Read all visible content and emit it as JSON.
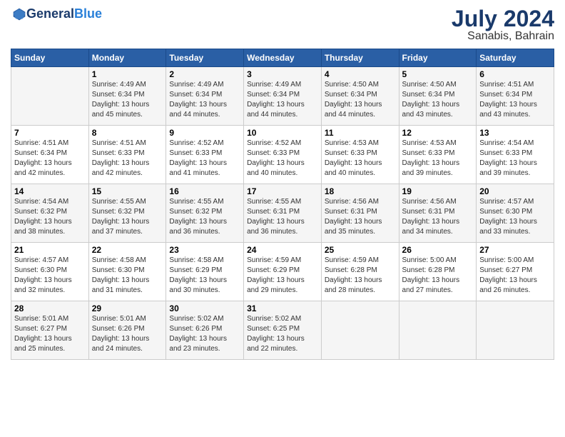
{
  "header": {
    "logo_line1": "General",
    "logo_line2": "Blue",
    "month_year": "July 2024",
    "location": "Sanabis, Bahrain"
  },
  "calendar": {
    "days_of_week": [
      "Sunday",
      "Monday",
      "Tuesday",
      "Wednesday",
      "Thursday",
      "Friday",
      "Saturday"
    ],
    "weeks": [
      [
        {
          "day": "",
          "info": ""
        },
        {
          "day": "1",
          "info": "Sunrise: 4:49 AM\nSunset: 6:34 PM\nDaylight: 13 hours\nand 45 minutes."
        },
        {
          "day": "2",
          "info": "Sunrise: 4:49 AM\nSunset: 6:34 PM\nDaylight: 13 hours\nand 44 minutes."
        },
        {
          "day": "3",
          "info": "Sunrise: 4:49 AM\nSunset: 6:34 PM\nDaylight: 13 hours\nand 44 minutes."
        },
        {
          "day": "4",
          "info": "Sunrise: 4:50 AM\nSunset: 6:34 PM\nDaylight: 13 hours\nand 44 minutes."
        },
        {
          "day": "5",
          "info": "Sunrise: 4:50 AM\nSunset: 6:34 PM\nDaylight: 13 hours\nand 43 minutes."
        },
        {
          "day": "6",
          "info": "Sunrise: 4:51 AM\nSunset: 6:34 PM\nDaylight: 13 hours\nand 43 minutes."
        }
      ],
      [
        {
          "day": "7",
          "info": "Sunrise: 4:51 AM\nSunset: 6:34 PM\nDaylight: 13 hours\nand 42 minutes."
        },
        {
          "day": "8",
          "info": "Sunrise: 4:51 AM\nSunset: 6:33 PM\nDaylight: 13 hours\nand 42 minutes."
        },
        {
          "day": "9",
          "info": "Sunrise: 4:52 AM\nSunset: 6:33 PM\nDaylight: 13 hours\nand 41 minutes."
        },
        {
          "day": "10",
          "info": "Sunrise: 4:52 AM\nSunset: 6:33 PM\nDaylight: 13 hours\nand 40 minutes."
        },
        {
          "day": "11",
          "info": "Sunrise: 4:53 AM\nSunset: 6:33 PM\nDaylight: 13 hours\nand 40 minutes."
        },
        {
          "day": "12",
          "info": "Sunrise: 4:53 AM\nSunset: 6:33 PM\nDaylight: 13 hours\nand 39 minutes."
        },
        {
          "day": "13",
          "info": "Sunrise: 4:54 AM\nSunset: 6:33 PM\nDaylight: 13 hours\nand 39 minutes."
        }
      ],
      [
        {
          "day": "14",
          "info": "Sunrise: 4:54 AM\nSunset: 6:32 PM\nDaylight: 13 hours\nand 38 minutes."
        },
        {
          "day": "15",
          "info": "Sunrise: 4:55 AM\nSunset: 6:32 PM\nDaylight: 13 hours\nand 37 minutes."
        },
        {
          "day": "16",
          "info": "Sunrise: 4:55 AM\nSunset: 6:32 PM\nDaylight: 13 hours\nand 36 minutes."
        },
        {
          "day": "17",
          "info": "Sunrise: 4:55 AM\nSunset: 6:31 PM\nDaylight: 13 hours\nand 36 minutes."
        },
        {
          "day": "18",
          "info": "Sunrise: 4:56 AM\nSunset: 6:31 PM\nDaylight: 13 hours\nand 35 minutes."
        },
        {
          "day": "19",
          "info": "Sunrise: 4:56 AM\nSunset: 6:31 PM\nDaylight: 13 hours\nand 34 minutes."
        },
        {
          "day": "20",
          "info": "Sunrise: 4:57 AM\nSunset: 6:30 PM\nDaylight: 13 hours\nand 33 minutes."
        }
      ],
      [
        {
          "day": "21",
          "info": "Sunrise: 4:57 AM\nSunset: 6:30 PM\nDaylight: 13 hours\nand 32 minutes."
        },
        {
          "day": "22",
          "info": "Sunrise: 4:58 AM\nSunset: 6:30 PM\nDaylight: 13 hours\nand 31 minutes."
        },
        {
          "day": "23",
          "info": "Sunrise: 4:58 AM\nSunset: 6:29 PM\nDaylight: 13 hours\nand 30 minutes."
        },
        {
          "day": "24",
          "info": "Sunrise: 4:59 AM\nSunset: 6:29 PM\nDaylight: 13 hours\nand 29 minutes."
        },
        {
          "day": "25",
          "info": "Sunrise: 4:59 AM\nSunset: 6:28 PM\nDaylight: 13 hours\nand 28 minutes."
        },
        {
          "day": "26",
          "info": "Sunrise: 5:00 AM\nSunset: 6:28 PM\nDaylight: 13 hours\nand 27 minutes."
        },
        {
          "day": "27",
          "info": "Sunrise: 5:00 AM\nSunset: 6:27 PM\nDaylight: 13 hours\nand 26 minutes."
        }
      ],
      [
        {
          "day": "28",
          "info": "Sunrise: 5:01 AM\nSunset: 6:27 PM\nDaylight: 13 hours\nand 25 minutes."
        },
        {
          "day": "29",
          "info": "Sunrise: 5:01 AM\nSunset: 6:26 PM\nDaylight: 13 hours\nand 24 minutes."
        },
        {
          "day": "30",
          "info": "Sunrise: 5:02 AM\nSunset: 6:26 PM\nDaylight: 13 hours\nand 23 minutes."
        },
        {
          "day": "31",
          "info": "Sunrise: 5:02 AM\nSunset: 6:25 PM\nDaylight: 13 hours\nand 22 minutes."
        },
        {
          "day": "",
          "info": ""
        },
        {
          "day": "",
          "info": ""
        },
        {
          "day": "",
          "info": ""
        }
      ]
    ]
  }
}
